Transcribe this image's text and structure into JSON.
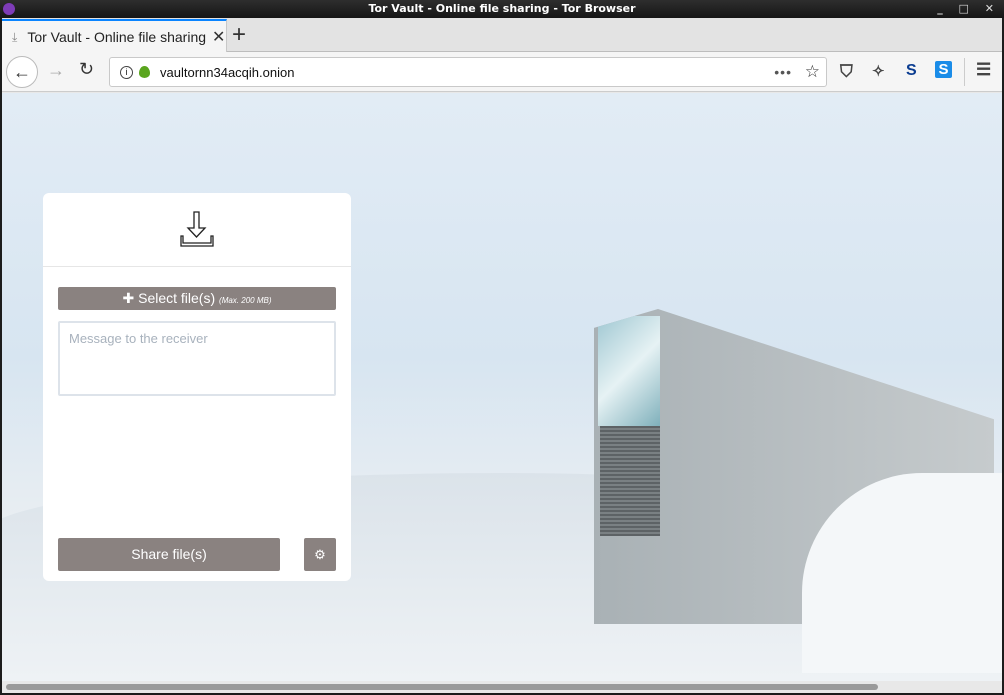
{
  "window": {
    "title": "Tor Vault - Online file sharing - Tor Browser",
    "controls": "_ □ ✕"
  },
  "tab": {
    "title": "Tor Vault - Online file sharing",
    "close": "✕",
    "new_tab": "+"
  },
  "nav": {
    "url": "vaultornn34acqih.onion",
    "back": "←",
    "forward": "→",
    "reload": "↻",
    "more": "•••",
    "bookmark": "☆",
    "menu": "☰"
  },
  "toolbar_icons": [
    "shield-icon",
    "broom-icon",
    "s-blue-icon",
    "skype-icon"
  ],
  "panel": {
    "select_label": "Select file(s)",
    "select_plus": "✚",
    "select_note": "(Max. 200 MB)",
    "message_placeholder": "Message to the receiver",
    "message_value": "",
    "share_label": "Share file(s)",
    "settings_glyph": "⚙"
  }
}
